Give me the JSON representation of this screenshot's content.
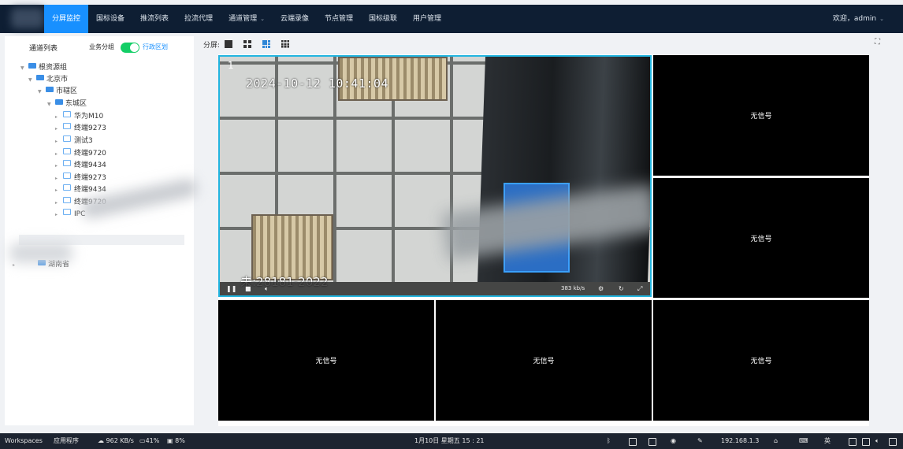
{
  "nav": {
    "items": [
      "分屏监控",
      "国标设备",
      "推流列表",
      "拉流代理",
      "通道管理",
      "云端录像",
      "节点管理",
      "国标级联",
      "用户管理"
    ],
    "active_index": 0,
    "user_label": "欢迎，admin"
  },
  "sidebar": {
    "title": "通道列表",
    "group_label": "业务分组",
    "toggle_on": true,
    "region_link": "行政区划",
    "tree": {
      "root": "根资源组",
      "city": "北京市",
      "district": "市辖区",
      "sub_district": "东城区",
      "channels": [
        "华为M10",
        "终端9273",
        "测试3",
        "终端9720",
        "终端9434",
        "终端9273",
        "终端9434",
        "终端9720",
        "IPC"
      ],
      "other_root": "湖南省"
    }
  },
  "toolbar": {
    "split_label": "分屏:",
    "layouts": [
      "1-screen-icon",
      "4-screen-icon",
      "6-screen-icon",
      "9-screen-icon"
    ],
    "active_layout": "6-screen-icon"
  },
  "video": {
    "main": {
      "index": "1",
      "timestamp": "2024-10-12 10:41:04",
      "bitrate": "383 kb/s",
      "osd_name": "未:28181-2022"
    },
    "no_signal": "无信号"
  },
  "taskbar": {
    "workspaces": "Workspaces",
    "apps": "应用程序",
    "net_speed": "962 KB/s",
    "cpu": "41%",
    "mem": "8%",
    "datetime": "1月10日 星期五 15 : 21",
    "ip": "192.168.1.3",
    "ime": "英"
  },
  "colors": {
    "nav_bg": "#0e1e33",
    "accent": "#1890ff",
    "toggle": "#13ce66",
    "active_border": "#22b5e0"
  }
}
